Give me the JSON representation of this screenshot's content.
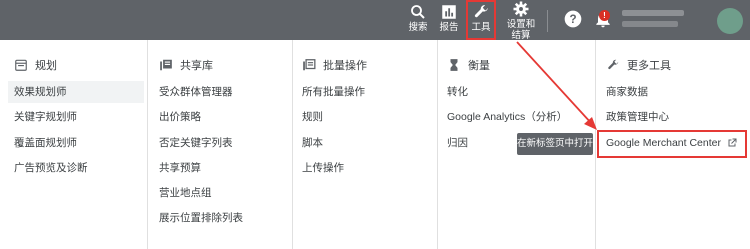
{
  "topbar": {
    "search_label": "搜索",
    "report_label": "报告",
    "tools_label": "工具",
    "settings_label_line1": "设置和",
    "settings_label_line2": "结算",
    "notifications_badge": "!"
  },
  "columns": [
    {
      "icon": "calendar-icon",
      "title": "规划",
      "items": [
        "效果规划师",
        "关键字规划师",
        "覆盖面规划师",
        "广告预览及诊断"
      ]
    },
    {
      "icon": "library-icon",
      "title": "共享库",
      "items": [
        "受众群体管理器",
        "出价策略",
        "否定关键字列表",
        "共享预算",
        "营业地点组",
        "展示位置排除列表"
      ]
    },
    {
      "icon": "bulk-actions-icon",
      "title": "批量操作",
      "items": [
        "所有批量操作",
        "规则",
        "脚本",
        "上传操作"
      ]
    },
    {
      "icon": "hourglass-icon",
      "title": "衡量",
      "items": [
        "转化",
        "Google Analytics（分析）",
        "归因"
      ]
    },
    {
      "icon": "wrench-icon",
      "title": "更多工具",
      "items": [
        "商家数据",
        "政策管理中心",
        "Google Merchant Center"
      ]
    }
  ],
  "tooltip": "在新标签页中打开",
  "colors": {
    "topbar_bg": "#5f6368",
    "highlight": "#e53935",
    "selected_bg": "#f1f3f4"
  }
}
